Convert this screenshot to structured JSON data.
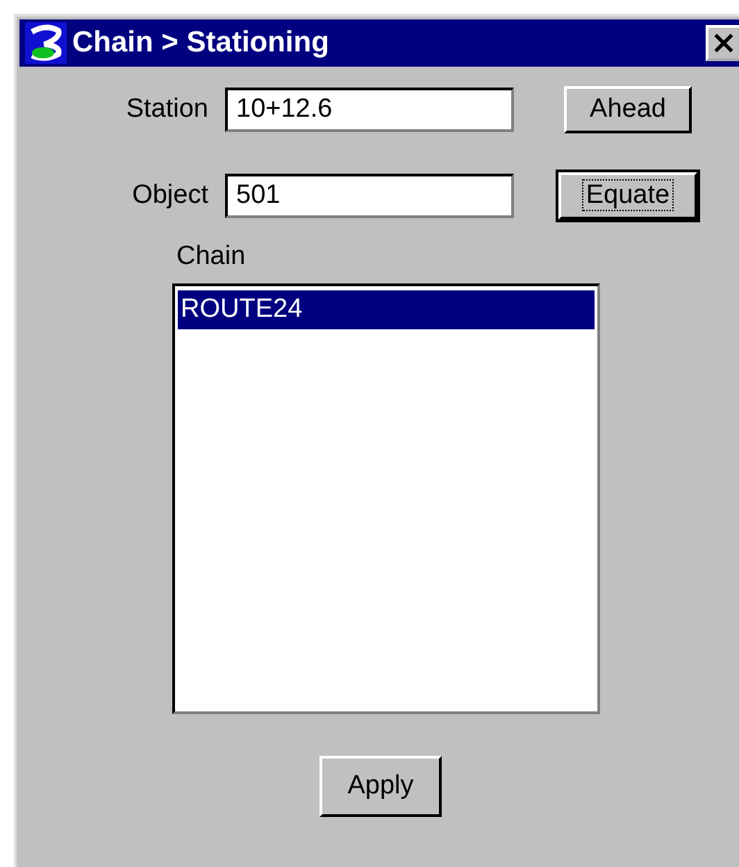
{
  "window": {
    "title": "Chain > Stationing"
  },
  "fields": [
    {
      "label": "Station",
      "value": "10+12.6",
      "button": "Ahead",
      "focused": false
    },
    {
      "label": "Object",
      "value": "501",
      "button": "Equate",
      "focused": true
    }
  ],
  "list": {
    "label": "Chain",
    "items": [
      {
        "text": "ROUTE24",
        "selected": true
      }
    ]
  },
  "apply_button": "Apply"
}
